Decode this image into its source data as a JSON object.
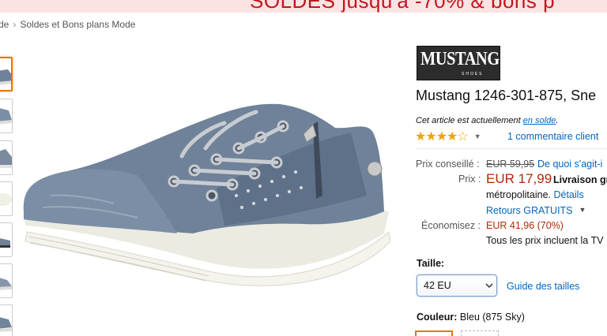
{
  "banner": {
    "text": "SOLDES  jusqu'à -70% & bons p"
  },
  "breadcrumb": {
    "items": [
      "de",
      "Soldes et Bons plans Mode"
    ]
  },
  "brand": {
    "logo": "MUSTANG",
    "logo_sub": "SHOES"
  },
  "product": {
    "title": "Mustang 1246-301-875, Sne",
    "sale_note_prefix": "Cet article est actuellement ",
    "sale_note_link": "en solde",
    "sale_note_suffix": ".",
    "rating_stars": "★★★★☆",
    "rating_value": 4,
    "reviews_link": "1 commentaire client"
  },
  "pricing": {
    "list_label": "Prix conseillé :",
    "list_price": "EUR 59,95",
    "list_explain": "De quoi s'agit-i",
    "price_label": "Prix :",
    "price": "EUR 17,99",
    "delivery": "Livraison gr",
    "delivery_line2": "métropolitaine.",
    "details_link": "Détails",
    "returns": "Retours GRATUITS",
    "savings_label": "Économisez :",
    "savings": "EUR 41,96 (70%)",
    "tax_note": "Tous les prix incluent la TV"
  },
  "size": {
    "label": "Taille:",
    "selected": "42 EU",
    "guide_link": "Guide des tailles"
  },
  "color": {
    "label": "Couleur:",
    "value": "Bleu (875 Sky)"
  },
  "colors": {
    "accent": "#e77600",
    "link": "#0066c0",
    "price": "#b12704",
    "star": "#f0a20c",
    "shoe": "#6f8299"
  }
}
